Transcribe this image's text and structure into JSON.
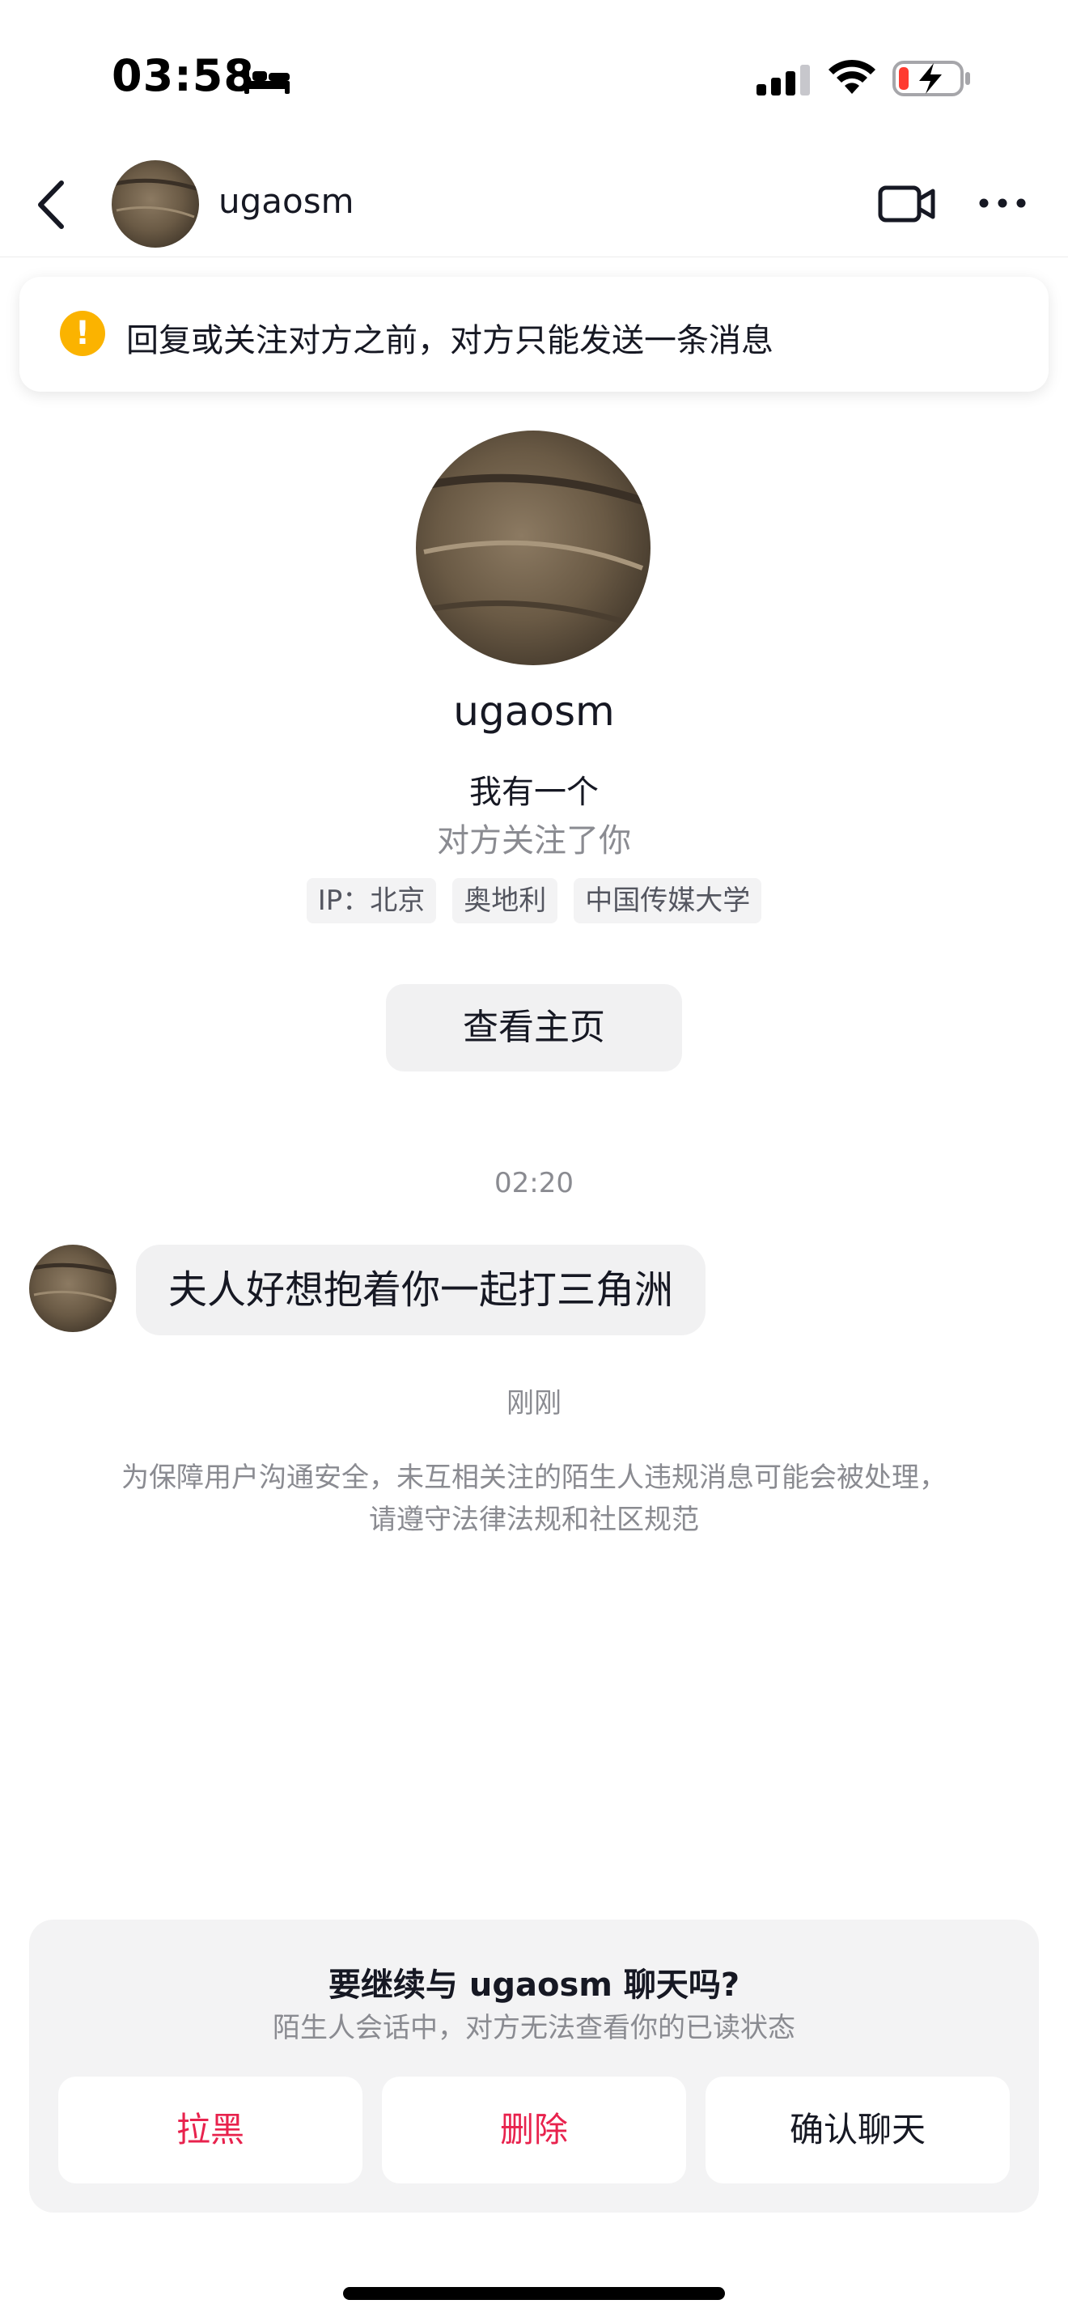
{
  "status_bar": {
    "time": "03:58",
    "icons": [
      "bed-icon",
      "signal-icon",
      "wifi-icon",
      "battery-charging-icon"
    ]
  },
  "header": {
    "back_icon": "chevron-left-icon",
    "username": "ugaosm",
    "actions": [
      "video-call-icon",
      "more-icon"
    ]
  },
  "notice": {
    "icon": "exclamation-icon",
    "text": "回复或关注对方之前，对方只能发送一条消息"
  },
  "profile": {
    "name": "ugaosm",
    "bio": "我有一个",
    "follow_status": "对方关注了你",
    "tags": [
      "IP：北京",
      "奥地利",
      "中国传媒大学"
    ],
    "homepage_button": "查看主页"
  },
  "conversation": {
    "time_label": "02:20",
    "messages": [
      {
        "text": "夫人好想抱着你一起打三角洲"
      }
    ],
    "just_now": "刚刚",
    "safety_notice": "为保障用户沟通安全，未互相关注的陌生人违规消息可能会被处理，请遵守法律法规和社区规范"
  },
  "bottom_panel": {
    "title": "要继续与 ugaosm 聊天吗?",
    "subtitle": "陌生人会话中，对方无法查看你的已读状态",
    "buttons": {
      "block": "拉黑",
      "delete": "删除",
      "confirm": "确认聊天"
    }
  },
  "colors": {
    "danger": "#e8224d",
    "warning": "#fbb300",
    "text_primary": "#161823",
    "text_secondary": "#8a8b91",
    "surface": "#f3f3f4"
  }
}
